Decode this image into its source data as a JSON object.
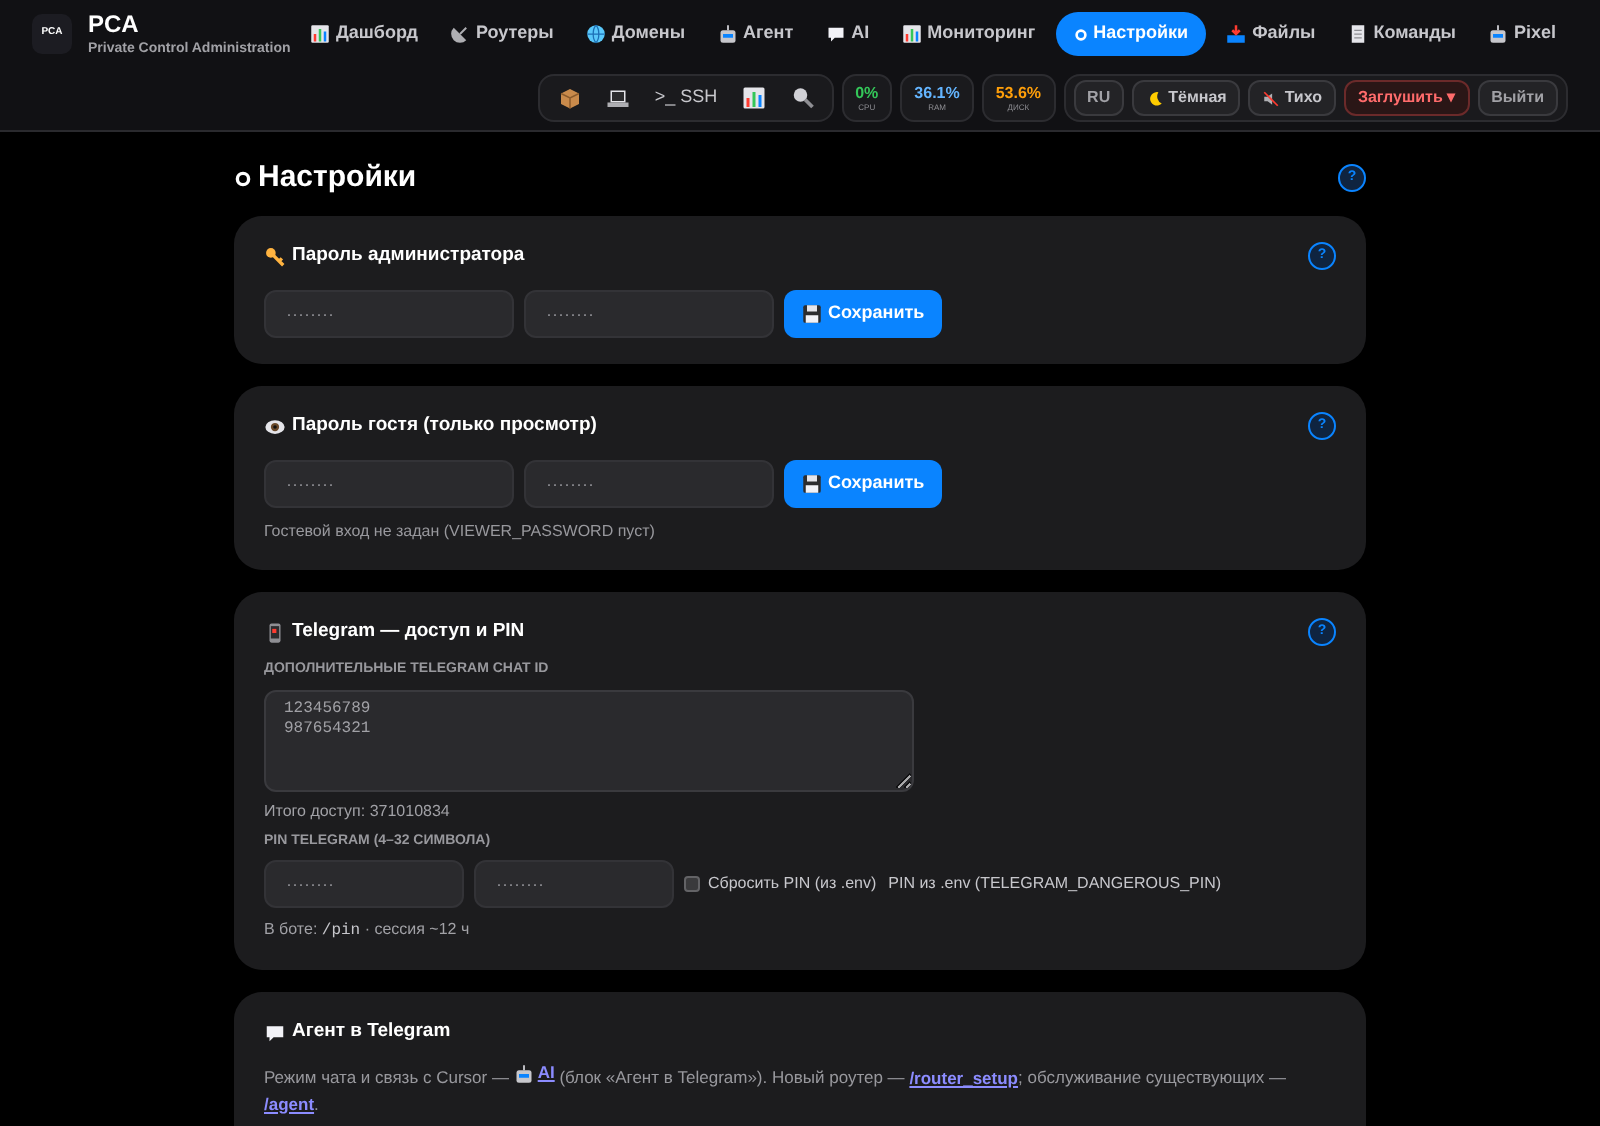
{
  "header": {
    "logo": {
      "mark": "PCA",
      "title": "PCA",
      "subtitle": "Private Control Administration"
    },
    "nav": [
      {
        "label": "Дашборд",
        "selected": false
      },
      {
        "label": "Роутеры",
        "selected": false
      },
      {
        "label": "Домены",
        "selected": false
      },
      {
        "label": "Агент",
        "selected": false
      },
      {
        "label": "AI",
        "selected": false
      },
      {
        "label": "Мониторинг",
        "selected": false
      },
      {
        "label": "Настройки",
        "selected": true
      },
      {
        "label": "Файлы",
        "selected": false
      },
      {
        "label": "Команды",
        "selected": false
      },
      {
        "label": "Pixel",
        "selected": false
      }
    ],
    "tools": [
      {
        "kind": "icon"
      },
      {
        "kind": "icon"
      },
      {
        "kind": "label",
        "label": ">_ SSH"
      },
      {
        "kind": "icon"
      },
      {
        "kind": "icon"
      }
    ],
    "meters": [
      {
        "value": "0%",
        "label": "CPU",
        "color": "#34c759"
      },
      {
        "value": "36.1%",
        "label": "RAM",
        "color": "#64b5ff"
      },
      {
        "value": "53.6%",
        "label": "ДИСК",
        "color": "#ff9f0a"
      }
    ],
    "controls": [
      {
        "kind": "plain",
        "label": "RU"
      },
      {
        "kind": "moon",
        "label": "Тёмная"
      },
      {
        "kind": "mute",
        "label": "Тихо"
      },
      {
        "kind": "danger",
        "label": "Заглушить ▾"
      },
      {
        "kind": "plain",
        "label": "Выйти"
      }
    ]
  },
  "page": {
    "title": "Настройки",
    "help": "?"
  },
  "sections": [
    {
      "kind": "password",
      "title": "Пароль администратора",
      "help": "?",
      "fields": [
        {
          "placeholder": "········"
        },
        {
          "placeholder": "········"
        }
      ],
      "button": "Сохранить"
    },
    {
      "kind": "password",
      "title": "Пароль гостя (только просмотр)",
      "help": "?",
      "fields": [
        {
          "placeholder": "········"
        },
        {
          "placeholder": "········"
        }
      ],
      "button": "Сохранить",
      "note": "Гостевой вход не задан (VIEWER_PASSWORD пуст)"
    },
    {
      "kind": "telegram",
      "title": "Telegram — доступ и PIN",
      "help": "?",
      "chat_label": "ДОПОЛНИТЕЛЬНЫЕ TELEGRAM CHAT ID",
      "chat_ids": "123456789\n987654321",
      "total": "Итого доступ: 371010834",
      "pin_label": "PIN TELEGRAM (4–32 СИМВОЛА)",
      "pin_fields": [
        {
          "placeholder": "········"
        },
        {
          "placeholder": "········"
        }
      ],
      "reset": {
        "label": "Сбросить PIN (из .env)",
        "checked": false
      },
      "pin_note": "PIN из .env (TELEGRAM_DANGEROUS_PIN)",
      "footer": [
        {
          "kind": "text",
          "text": "В боте: "
        },
        {
          "kind": "code",
          "text": "/pin"
        },
        {
          "kind": "text",
          "text": " · сессия ~12 ч"
        }
      ]
    },
    {
      "kind": "agent",
      "title": "Агент в Telegram",
      "paragraph": [
        {
          "kind": "text",
          "text": "Режим чата и связь с Cursor — "
        },
        {
          "kind": "link",
          "text": "AI"
        },
        {
          "kind": "text",
          "text": " (блок «Агент в Telegram»). Новый роутер — "
        },
        {
          "kind": "link",
          "text": "/router_setup"
        },
        {
          "kind": "text",
          "text": "; обслуживание существующих — "
        },
        {
          "kind": "link",
          "text": "/agent"
        },
        {
          "kind": "text",
          "text": "."
        }
      ]
    }
  ]
}
